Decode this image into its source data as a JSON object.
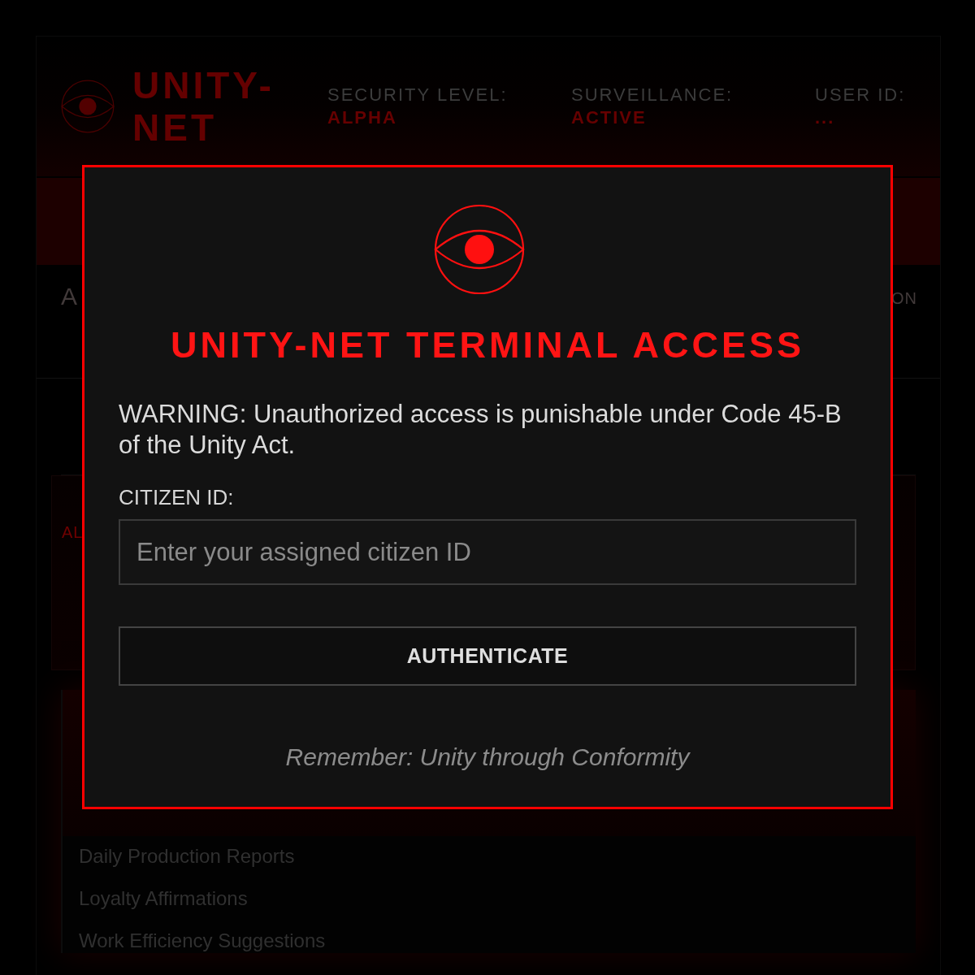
{
  "header": {
    "logo": "UNITY-NET",
    "stats": [
      {
        "label": "SECURITY LEVEL:",
        "value": "ALPHA"
      },
      {
        "label": "SURVEILLANCE:",
        "value": "ACTIVE"
      },
      {
        "label": "USER ID:",
        "value": "..."
      }
    ]
  },
  "background": {
    "section_heading": "A",
    "section_aside": "ON",
    "card_label": "AL",
    "topics": [
      "Daily Production Reports",
      "Loyalty Affirmations",
      "Work Efficiency Suggestions"
    ]
  },
  "modal": {
    "title": "UNITY-NET TERMINAL ACCESS",
    "warning": "WARNING: Unauthorized access is punishable under Code 45-B of the Unity Act.",
    "field_label": "CITIZEN ID:",
    "citizen_id": {
      "placeholder": "Enter your assigned citizen ID"
    },
    "button": "AUTHENTICATE",
    "footer": "Remember: Unity through Conformity"
  }
}
